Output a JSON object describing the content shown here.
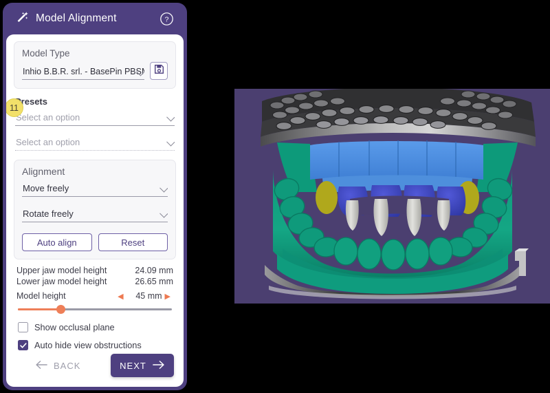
{
  "window": {
    "header": {
      "title": "Model Alignment",
      "wand_icon": "magic-wand-icon",
      "help_icon": "help-circle-icon"
    }
  },
  "model_type": {
    "label": "Model Type",
    "selected": "Inhio B.B.R. srl. - BasePin PBSM",
    "chevron_icon": "chevron-down-icon",
    "save_icon": "save-floppy-icon",
    "badge": "11"
  },
  "presets": {
    "label": "Presets",
    "first": {
      "value": "Select an option",
      "chevron_icon": "chevron-down-icon"
    },
    "second": {
      "value": "Select an option",
      "chevron_icon": "chevron-down-icon"
    }
  },
  "alignment": {
    "title": "Alignment",
    "move": {
      "value": "Move freely",
      "chevron_icon": "chevron-down-icon"
    },
    "rotate": {
      "value": "Rotate freely",
      "chevron_icon": "chevron-down-icon"
    },
    "auto_align_label": "Auto align",
    "reset_label": "Reset"
  },
  "measurements": {
    "upper_label": "Upper jaw model height",
    "upper_value": "24.09 mm",
    "lower_label": "Lower jaw model height",
    "lower_value": "26.65 mm",
    "model_height_label": "Model height",
    "model_height_value": "45 mm",
    "stepper_decrement_icon": "triangle-left-icon",
    "stepper_increment_icon": "triangle-right-icon"
  },
  "options": {
    "occlusal": {
      "label": "Show occlusal plane",
      "checked": false
    },
    "auto_hide": {
      "label": "Auto hide view obstructions",
      "checked": true,
      "check_icon": "checkmark-icon"
    }
  },
  "footer": {
    "back_label": "BACK",
    "back_icon": "arrow-left-icon",
    "next_label": "NEXT",
    "next_icon": "arrow-right-icon"
  },
  "viewport": {
    "name": "3d-model-viewport",
    "background": "#4b3f70",
    "model_colors": {
      "gingiva": "#14a383",
      "plate": "#3a3a3c",
      "pins": "#8d8d90",
      "blue_band": "#4a8ee0",
      "dark_blue": "#3b43bd",
      "yellow_margin": "#b5ad1f",
      "tooth_white": "#d9d9d5"
    }
  }
}
